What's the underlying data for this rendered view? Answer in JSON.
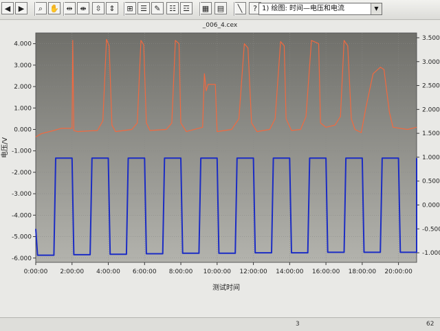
{
  "toolbar": {
    "buttons": [
      {
        "icon": "arrow-left-icon",
        "glyph": "◀"
      },
      {
        "icon": "arrow-right-icon",
        "glyph": "▶"
      },
      {
        "icon": "zoom-icon",
        "glyph": "⌕"
      },
      {
        "icon": "hand-pan-icon",
        "glyph": "✋"
      },
      {
        "icon": "zoom-x-in-icon",
        "glyph": "⇹"
      },
      {
        "icon": "zoom-x-out-icon",
        "glyph": "⇼"
      },
      {
        "icon": "zoom-y-in-icon",
        "glyph": "⇳"
      },
      {
        "icon": "zoom-y-out-icon",
        "glyph": "⇕"
      },
      {
        "icon": "fit-all-icon",
        "glyph": "⊞"
      },
      {
        "icon": "list-icon",
        "glyph": "☰"
      },
      {
        "icon": "edit-list-icon",
        "glyph": "✎"
      },
      {
        "icon": "list-detail-icon",
        "glyph": "☷"
      },
      {
        "icon": "list-add-icon",
        "glyph": "☲"
      },
      {
        "icon": "grid-icon",
        "glyph": "▦"
      },
      {
        "icon": "table-icon",
        "glyph": "▤"
      },
      {
        "icon": "line-tool-icon",
        "glyph": "╲"
      },
      {
        "icon": "help-icon",
        "glyph": "?"
      }
    ],
    "plot_select": {
      "value": "1) 绘图: 时间—电压和电流"
    }
  },
  "chart_window": {
    "file_title": "_006_4.cex"
  },
  "status": {
    "items": [
      "3",
      "62"
    ]
  },
  "colors": {
    "plot_bg_top": "#6f6f6a",
    "plot_bg_bottom": "#b3b3ad",
    "voltage": "#f2693f",
    "current": "#1b2cc4",
    "grid": "#8a8a86"
  },
  "chart_data": {
    "type": "line",
    "xlabel": "测试时间",
    "ylabel_left": "电压/V",
    "ylabel_right": "",
    "x_unit": "hours",
    "xlim": [
      0,
      21
    ],
    "xticks": [
      "0:00:00",
      "2:00:00",
      "4:00:00",
      "6:00:00",
      "8:00:00",
      "10:00:00",
      "12:00:00",
      "14:00:00",
      "16:00:00",
      "18:00:00",
      "20:00:00"
    ],
    "ylim_left": [
      -6.2,
      4.5
    ],
    "yticks_left": [
      "4.000",
      "3.000",
      "2.000",
      "1.000",
      "0.000",
      "-1.000",
      "-2.000",
      "-3.000",
      "-4.000",
      "-5.000",
      "-6.000"
    ],
    "ylim_right": [
      -1.2,
      3.6
    ],
    "yticks_right": [
      "3.500",
      "3.000",
      "2.500",
      "2.000",
      "1.500",
      "1.000",
      "0.500",
      "0.000",
      "-0.500",
      "-1.000"
    ],
    "grid": true,
    "series": [
      {
        "axis": "left",
        "points": [
          [
            0,
            -0.35
          ],
          [
            0.3,
            -0.2
          ],
          [
            1.0,
            -0.05
          ],
          [
            1.4,
            0.05
          ],
          [
            2.0,
            0.05
          ],
          [
            2.04,
            4.15
          ],
          [
            2.1,
            -0.05
          ],
          [
            2.3,
            -0.1
          ],
          [
            3.4,
            -0.05
          ],
          [
            3.7,
            0.4
          ],
          [
            3.9,
            4.2
          ],
          [
            4.05,
            3.9
          ],
          [
            4.2,
            0.2
          ],
          [
            4.4,
            -0.1
          ],
          [
            5.3,
            0.0
          ],
          [
            5.6,
            0.3
          ],
          [
            5.8,
            4.15
          ],
          [
            5.95,
            3.95
          ],
          [
            6.1,
            0.3
          ],
          [
            6.3,
            -0.05
          ],
          [
            7.2,
            0.0
          ],
          [
            7.5,
            0.3
          ],
          [
            7.7,
            4.15
          ],
          [
            7.9,
            4.0
          ],
          [
            8.0,
            0.3
          ],
          [
            8.3,
            -0.1
          ],
          [
            9.2,
            0.1
          ],
          [
            9.3,
            2.6
          ],
          [
            9.4,
            1.8
          ],
          [
            9.5,
            2.1
          ],
          [
            9.9,
            2.1
          ],
          [
            10.0,
            -0.1
          ],
          [
            10.8,
            0.0
          ],
          [
            11.2,
            0.5
          ],
          [
            11.5,
            4.0
          ],
          [
            11.7,
            3.8
          ],
          [
            11.9,
            0.3
          ],
          [
            12.2,
            -0.1
          ],
          [
            12.9,
            0.0
          ],
          [
            13.2,
            0.5
          ],
          [
            13.5,
            4.1
          ],
          [
            13.7,
            3.9
          ],
          [
            13.8,
            0.5
          ],
          [
            14.1,
            -0.05
          ],
          [
            14.6,
            0.0
          ],
          [
            14.9,
            0.6
          ],
          [
            15.2,
            4.15
          ],
          [
            15.6,
            4.0
          ],
          [
            15.7,
            0.3
          ],
          [
            16.0,
            0.1
          ],
          [
            16.5,
            0.2
          ],
          [
            16.8,
            0.6
          ],
          [
            17.0,
            4.15
          ],
          [
            17.2,
            3.9
          ],
          [
            17.4,
            0.5
          ],
          [
            17.6,
            0.0
          ],
          [
            17.95,
            -0.15
          ],
          [
            18.2,
            1.0
          ],
          [
            18.6,
            2.6
          ],
          [
            19.0,
            2.9
          ],
          [
            19.2,
            2.8
          ],
          [
            19.5,
            0.8
          ],
          [
            19.7,
            0.1
          ],
          [
            20.5,
            0.0
          ],
          [
            21.0,
            0.1
          ]
        ]
      },
      {
        "axis": "right",
        "points": [
          [
            0,
            -0.5
          ],
          [
            0.1,
            -1.05
          ],
          [
            1.0,
            -1.05
          ],
          [
            1.1,
            0.98
          ],
          [
            2.0,
            0.98
          ],
          [
            2.1,
            -1.04
          ],
          [
            3.0,
            -1.04
          ],
          [
            3.1,
            0.98
          ],
          [
            4.0,
            0.98
          ],
          [
            4.1,
            -1.03
          ],
          [
            5.0,
            -1.03
          ],
          [
            5.1,
            0.98
          ],
          [
            6.0,
            0.98
          ],
          [
            6.1,
            -1.02
          ],
          [
            7.0,
            -1.02
          ],
          [
            7.1,
            0.98
          ],
          [
            8.0,
            0.98
          ],
          [
            8.1,
            -1.01
          ],
          [
            9.0,
            -1.01
          ],
          [
            9.1,
            0.98
          ],
          [
            10.0,
            0.98
          ],
          [
            10.1,
            -1.01
          ],
          [
            11.0,
            -1.01
          ],
          [
            11.1,
            0.98
          ],
          [
            12.0,
            0.98
          ],
          [
            12.1,
            -1.0
          ],
          [
            13.0,
            -1.0
          ],
          [
            13.1,
            0.98
          ],
          [
            14.0,
            0.98
          ],
          [
            14.1,
            -1.0
          ],
          [
            15.0,
            -1.0
          ],
          [
            15.1,
            0.98
          ],
          [
            16.0,
            0.98
          ],
          [
            16.1,
            -0.99
          ],
          [
            17.0,
            -0.99
          ],
          [
            17.1,
            0.98
          ],
          [
            18.0,
            0.98
          ],
          [
            18.1,
            -0.99
          ],
          [
            19.0,
            -0.99
          ],
          [
            19.1,
            0.98
          ],
          [
            20.0,
            0.98
          ],
          [
            20.1,
            -0.99
          ],
          [
            21.0,
            -0.99
          ],
          [
            21.1,
            0.98
          ]
        ]
      }
    ]
  }
}
